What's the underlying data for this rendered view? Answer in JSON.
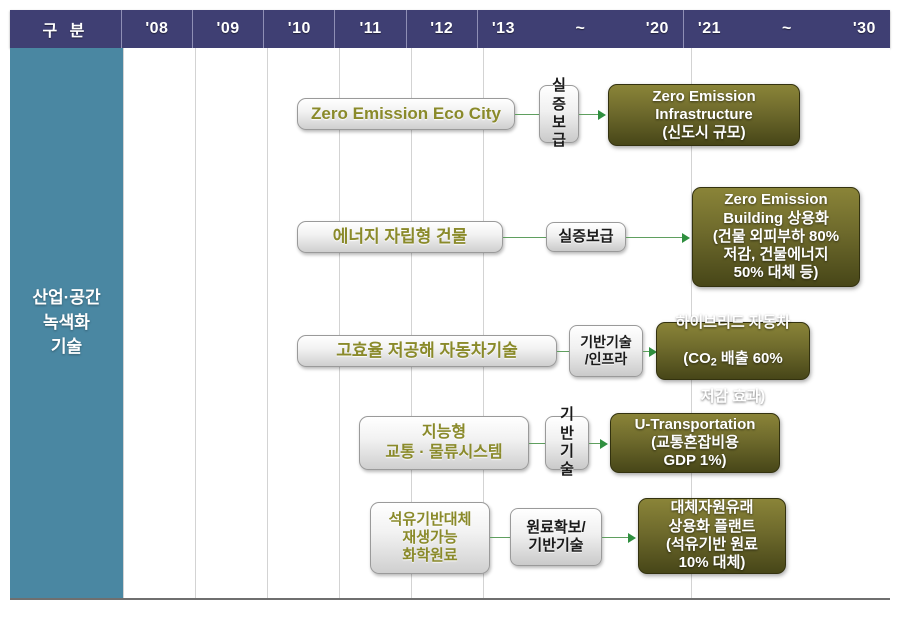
{
  "table": {
    "header": {
      "category_label": "구 분",
      "years": [
        "'08",
        "'09",
        "'10",
        "'11",
        "'12"
      ],
      "spans": [
        {
          "start": "'13",
          "tilde": "~",
          "end": "'20"
        },
        {
          "start": "'21",
          "tilde": "~",
          "end": "'30"
        }
      ]
    },
    "category": {
      "label": "산업·공간\n녹색화\n기술"
    }
  },
  "colors": {
    "header_bg": "#3f3f73",
    "category_bg": "#4a87a2",
    "outcome_box": "#6e6a2c",
    "source_text": "#8a8a2a",
    "connector": "#5f9f5f"
  },
  "rows": [
    {
      "source": "Zero Emission Eco City",
      "connector_label": "실증\n보급",
      "outcome": "Zero Emission\nInfrastructure\n(신도시 규모)"
    },
    {
      "source": "에너지 자립형 건물",
      "connector_label": "실증보급",
      "outcome": "Zero Emission\nBuilding 상용화\n(건물 외피부하 80%\n저감, 건물에너지\n50% 대체 등)"
    },
    {
      "source": "고효율 저공해 자동차기술",
      "connector_label": "기반기술\n/인프라",
      "outcome_line1": "하이브리드 자동차",
      "outcome_line2_pre": "(CO",
      "outcome_line2_sub": "2",
      "outcome_line2_post": " 배출 60%",
      "outcome_line3": "저감 효과)"
    },
    {
      "source": "지능형\n교통 · 물류시스템",
      "connector_label": "기반\n기술",
      "outcome": "U-Transportation\n(교통혼잡비용\nGDP 1%)"
    },
    {
      "source": "석유기반대체\n재생가능\n화학원료",
      "connector_label": "원료확보/\n기반기술",
      "outcome": "대체자원유래\n상용화 플랜트\n(석유기반 원료\n10% 대체)"
    }
  ]
}
